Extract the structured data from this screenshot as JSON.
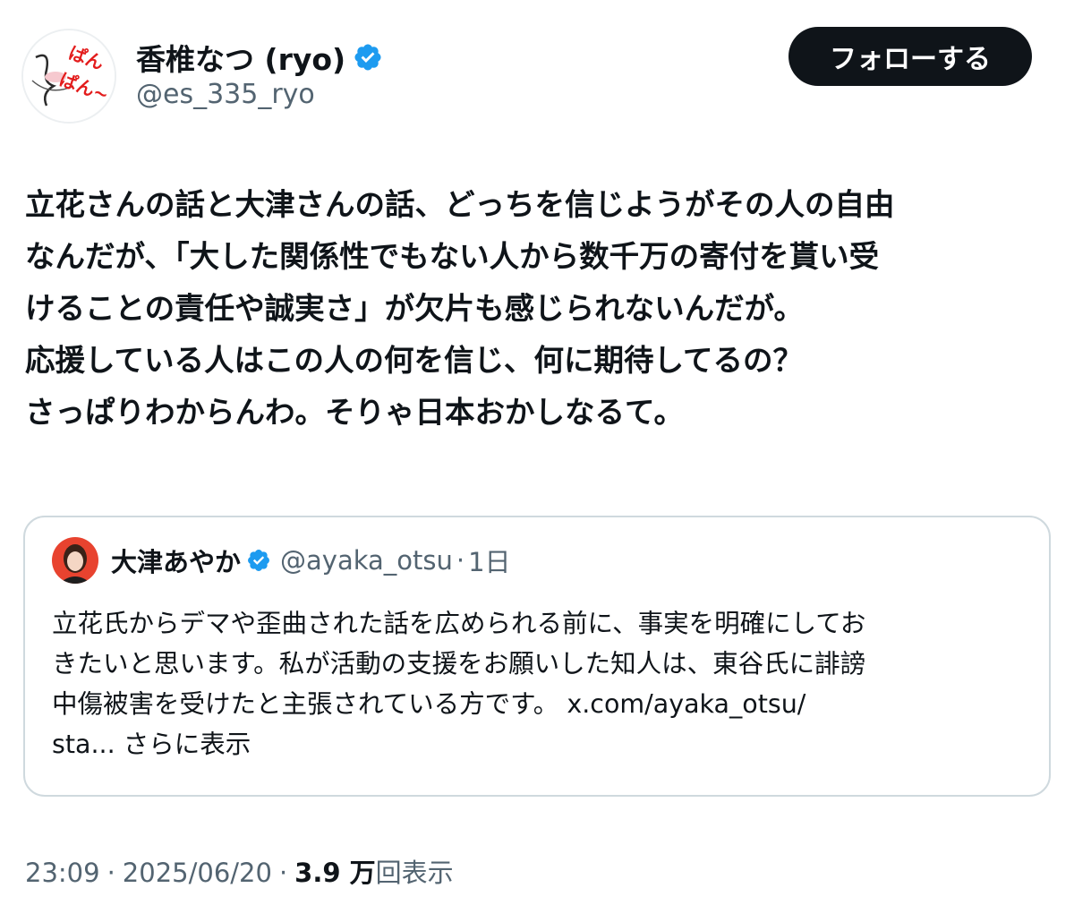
{
  "author": {
    "name": "香椎なつ (ryo)",
    "handle": "@es_335_ryo",
    "verified": true
  },
  "follow_button": {
    "label": "フォローする"
  },
  "tweet": {
    "lines": [
      "立花さんの話と大津さんの話、どっちを信じようがその人の自由",
      "なんだが、「大した関係性でもない人から数千万の寄付を貰い受",
      "けることの責任や誠実さ」が欠片も感じられないんだが。",
      "応援している人はこの人の何を信じ、何に期待してるの？",
      "さっぱりわからんわ。そりゃ日本おかしなるて。"
    ]
  },
  "quote": {
    "name": "大津あやか",
    "handle": "@ayaka_otsu",
    "separator": "·",
    "time": "1日",
    "lines": [
      "立花氏からデマや歪曲された話を広められる前に、事実を明確にしてお",
      "きたいと思います。私が活動の支援をお願いした知人は、東谷氏に誹謗",
      "中傷被害を受けたと主張されている方です。 x.com/ayaka_otsu/"
    ],
    "last_line": "sta...",
    "show_more": "さらに表示"
  },
  "meta": {
    "time": "23:09",
    "date": "2025/06/20",
    "separator": "·",
    "views_count": "3.9 万",
    "views_label": "回表示"
  },
  "colors": {
    "text": "#0f1419",
    "secondary": "#536471",
    "verified": "#1d9bf0",
    "border": "#cfd9de",
    "button_bg": "#0f1419"
  },
  "icons": {
    "verified": "verified-badge-icon",
    "avatar": "profile-avatar",
    "quote_avatar": "quote-author-avatar"
  }
}
